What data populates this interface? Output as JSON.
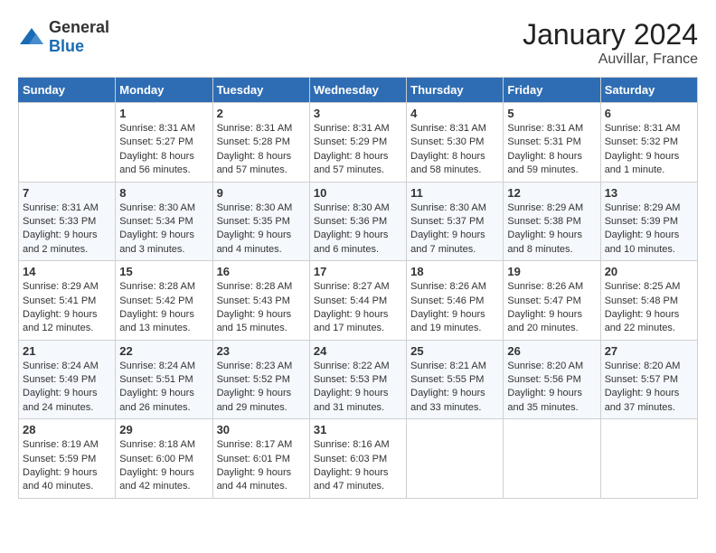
{
  "header": {
    "logo_general": "General",
    "logo_blue": "Blue",
    "month": "January 2024",
    "location": "Auvillar, France"
  },
  "weekdays": [
    "Sunday",
    "Monday",
    "Tuesday",
    "Wednesday",
    "Thursday",
    "Friday",
    "Saturday"
  ],
  "weeks": [
    [
      {
        "day": "",
        "sunrise": "",
        "sunset": "",
        "daylight": ""
      },
      {
        "day": "1",
        "sunrise": "Sunrise: 8:31 AM",
        "sunset": "Sunset: 5:27 PM",
        "daylight": "Daylight: 8 hours and 56 minutes."
      },
      {
        "day": "2",
        "sunrise": "Sunrise: 8:31 AM",
        "sunset": "Sunset: 5:28 PM",
        "daylight": "Daylight: 8 hours and 57 minutes."
      },
      {
        "day": "3",
        "sunrise": "Sunrise: 8:31 AM",
        "sunset": "Sunset: 5:29 PM",
        "daylight": "Daylight: 8 hours and 57 minutes."
      },
      {
        "day": "4",
        "sunrise": "Sunrise: 8:31 AM",
        "sunset": "Sunset: 5:30 PM",
        "daylight": "Daylight: 8 hours and 58 minutes."
      },
      {
        "day": "5",
        "sunrise": "Sunrise: 8:31 AM",
        "sunset": "Sunset: 5:31 PM",
        "daylight": "Daylight: 8 hours and 59 minutes."
      },
      {
        "day": "6",
        "sunrise": "Sunrise: 8:31 AM",
        "sunset": "Sunset: 5:32 PM",
        "daylight": "Daylight: 9 hours and 1 minute."
      }
    ],
    [
      {
        "day": "7",
        "sunrise": "Sunrise: 8:31 AM",
        "sunset": "Sunset: 5:33 PM",
        "daylight": "Daylight: 9 hours and 2 minutes."
      },
      {
        "day": "8",
        "sunrise": "Sunrise: 8:30 AM",
        "sunset": "Sunset: 5:34 PM",
        "daylight": "Daylight: 9 hours and 3 minutes."
      },
      {
        "day": "9",
        "sunrise": "Sunrise: 8:30 AM",
        "sunset": "Sunset: 5:35 PM",
        "daylight": "Daylight: 9 hours and 4 minutes."
      },
      {
        "day": "10",
        "sunrise": "Sunrise: 8:30 AM",
        "sunset": "Sunset: 5:36 PM",
        "daylight": "Daylight: 9 hours and 6 minutes."
      },
      {
        "day": "11",
        "sunrise": "Sunrise: 8:30 AM",
        "sunset": "Sunset: 5:37 PM",
        "daylight": "Daylight: 9 hours and 7 minutes."
      },
      {
        "day": "12",
        "sunrise": "Sunrise: 8:29 AM",
        "sunset": "Sunset: 5:38 PM",
        "daylight": "Daylight: 9 hours and 8 minutes."
      },
      {
        "day": "13",
        "sunrise": "Sunrise: 8:29 AM",
        "sunset": "Sunset: 5:39 PM",
        "daylight": "Daylight: 9 hours and 10 minutes."
      }
    ],
    [
      {
        "day": "14",
        "sunrise": "Sunrise: 8:29 AM",
        "sunset": "Sunset: 5:41 PM",
        "daylight": "Daylight: 9 hours and 12 minutes."
      },
      {
        "day": "15",
        "sunrise": "Sunrise: 8:28 AM",
        "sunset": "Sunset: 5:42 PM",
        "daylight": "Daylight: 9 hours and 13 minutes."
      },
      {
        "day": "16",
        "sunrise": "Sunrise: 8:28 AM",
        "sunset": "Sunset: 5:43 PM",
        "daylight": "Daylight: 9 hours and 15 minutes."
      },
      {
        "day": "17",
        "sunrise": "Sunrise: 8:27 AM",
        "sunset": "Sunset: 5:44 PM",
        "daylight": "Daylight: 9 hours and 17 minutes."
      },
      {
        "day": "18",
        "sunrise": "Sunrise: 8:26 AM",
        "sunset": "Sunset: 5:46 PM",
        "daylight": "Daylight: 9 hours and 19 minutes."
      },
      {
        "day": "19",
        "sunrise": "Sunrise: 8:26 AM",
        "sunset": "Sunset: 5:47 PM",
        "daylight": "Daylight: 9 hours and 20 minutes."
      },
      {
        "day": "20",
        "sunrise": "Sunrise: 8:25 AM",
        "sunset": "Sunset: 5:48 PM",
        "daylight": "Daylight: 9 hours and 22 minutes."
      }
    ],
    [
      {
        "day": "21",
        "sunrise": "Sunrise: 8:24 AM",
        "sunset": "Sunset: 5:49 PM",
        "daylight": "Daylight: 9 hours and 24 minutes."
      },
      {
        "day": "22",
        "sunrise": "Sunrise: 8:24 AM",
        "sunset": "Sunset: 5:51 PM",
        "daylight": "Daylight: 9 hours and 26 minutes."
      },
      {
        "day": "23",
        "sunrise": "Sunrise: 8:23 AM",
        "sunset": "Sunset: 5:52 PM",
        "daylight": "Daylight: 9 hours and 29 minutes."
      },
      {
        "day": "24",
        "sunrise": "Sunrise: 8:22 AM",
        "sunset": "Sunset: 5:53 PM",
        "daylight": "Daylight: 9 hours and 31 minutes."
      },
      {
        "day": "25",
        "sunrise": "Sunrise: 8:21 AM",
        "sunset": "Sunset: 5:55 PM",
        "daylight": "Daylight: 9 hours and 33 minutes."
      },
      {
        "day": "26",
        "sunrise": "Sunrise: 8:20 AM",
        "sunset": "Sunset: 5:56 PM",
        "daylight": "Daylight: 9 hours and 35 minutes."
      },
      {
        "day": "27",
        "sunrise": "Sunrise: 8:20 AM",
        "sunset": "Sunset: 5:57 PM",
        "daylight": "Daylight: 9 hours and 37 minutes."
      }
    ],
    [
      {
        "day": "28",
        "sunrise": "Sunrise: 8:19 AM",
        "sunset": "Sunset: 5:59 PM",
        "daylight": "Daylight: 9 hours and 40 minutes."
      },
      {
        "day": "29",
        "sunrise": "Sunrise: 8:18 AM",
        "sunset": "Sunset: 6:00 PM",
        "daylight": "Daylight: 9 hours and 42 minutes."
      },
      {
        "day": "30",
        "sunrise": "Sunrise: 8:17 AM",
        "sunset": "Sunset: 6:01 PM",
        "daylight": "Daylight: 9 hours and 44 minutes."
      },
      {
        "day": "31",
        "sunrise": "Sunrise: 8:16 AM",
        "sunset": "Sunset: 6:03 PM",
        "daylight": "Daylight: 9 hours and 47 minutes."
      },
      {
        "day": "",
        "sunrise": "",
        "sunset": "",
        "daylight": ""
      },
      {
        "day": "",
        "sunrise": "",
        "sunset": "",
        "daylight": ""
      },
      {
        "day": "",
        "sunrise": "",
        "sunset": "",
        "daylight": ""
      }
    ]
  ]
}
